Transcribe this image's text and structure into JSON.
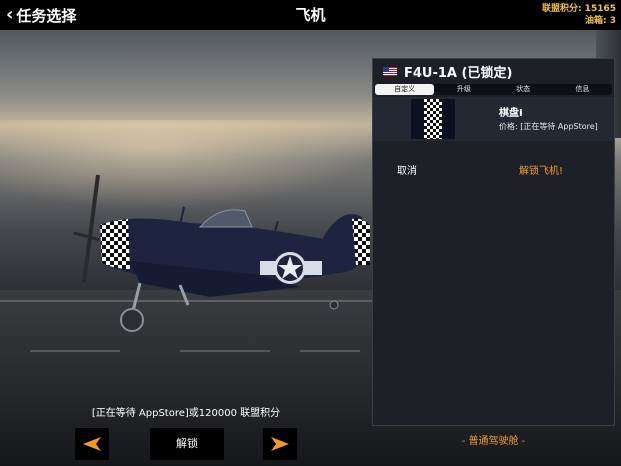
{
  "header": {
    "back_label": "任务选择",
    "title": "飞机",
    "alliance_points": "联盟积分: 15165",
    "fuel": "油箱: 3"
  },
  "panel": {
    "plane_name": "F4U-1A (已锁定)",
    "tabs": [
      {
        "label": "自定义",
        "active": true
      },
      {
        "label": "升级",
        "active": false
      },
      {
        "label": "状态",
        "active": false
      },
      {
        "label": "信息",
        "active": false
      }
    ],
    "skin": {
      "name": "棋盘I",
      "price": "价格: [正在等待 AppStore]"
    },
    "cancel_label": "取消",
    "unlock_plane_label": "解锁飞机!"
  },
  "bottom": {
    "cost_text": "[正在等待 AppStore]或120000 联盟积分",
    "unlock_label": "解锁",
    "cockpit_label": "- 普通驾驶舱 -"
  },
  "colors": {
    "accent": "#f39a2b",
    "stats": "#f2c14a",
    "panel_bg": "#1d2027",
    "plane_body": "#1e2440"
  },
  "icons": {
    "back": "chevron-left-icon",
    "prev": "arrow-left-icon",
    "next": "arrow-right-icon",
    "flag": "us-flag-icon"
  }
}
